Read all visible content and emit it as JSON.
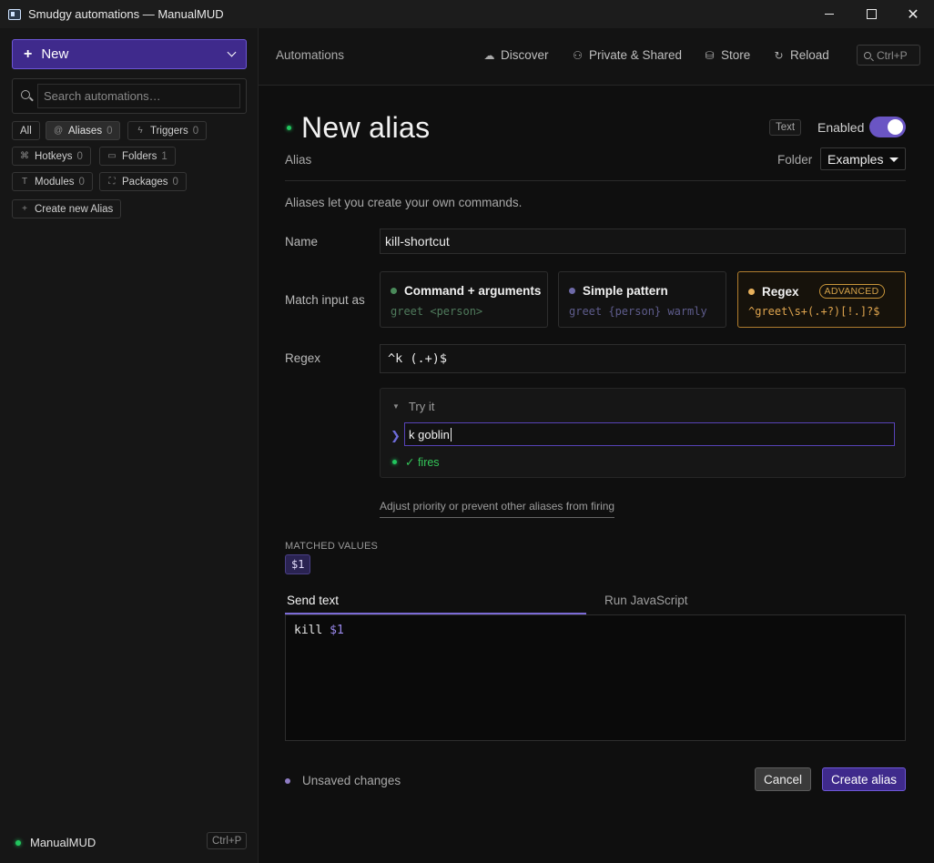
{
  "window": {
    "title": "Smudgy automations — ManualMUD"
  },
  "sidebar": {
    "new_label": "New",
    "search_placeholder": "Search automations…",
    "filters": [
      {
        "label": "All",
        "count": ""
      },
      {
        "label": "Aliases",
        "count": "0"
      },
      {
        "label": "Triggers",
        "count": "0"
      },
      {
        "label": "Hotkeys",
        "count": "0"
      },
      {
        "label": "Folders",
        "count": "1"
      },
      {
        "label": "Modules",
        "count": "0"
      },
      {
        "label": "Packages",
        "count": "0"
      },
      {
        "label": "Create new Alias",
        "count": ""
      }
    ],
    "bottom": {
      "mud_name": "ManualMUD",
      "shortcut": "Ctrl+P"
    }
  },
  "topbar": {
    "title": "Automations",
    "items": [
      {
        "label": "Discover",
        "icon": "cloud-icon"
      },
      {
        "label": "Private & Shared",
        "icon": "user-lock-icon"
      },
      {
        "label": "Store",
        "icon": "database-icon"
      },
      {
        "label": "Reload",
        "icon": "reload-icon"
      }
    ],
    "search_shortcut": "Ctrl+P"
  },
  "form": {
    "title": "New alias",
    "subtitle": "Alias",
    "text_badge": "Text",
    "enabled_label": "Enabled",
    "enabled": true,
    "folder_label": "Folder",
    "folder_value": "Examples",
    "description": "Aliases let you create your own commands.",
    "name_label": "Name",
    "name_value": "kill-shortcut",
    "match_label": "Match input as",
    "match_options": [
      {
        "title": "Command + arguments",
        "example": "greet <person>",
        "dot_color": "#4a8a5a"
      },
      {
        "title": "Simple pattern",
        "example": "greet {person} warmly",
        "dot_color": "#6e6aa8"
      },
      {
        "title": "Regex",
        "badge": "ADVANCED",
        "example": "^greet\\s+(.+?)[!.]?$",
        "dot_color": "#e8b15c"
      }
    ],
    "regex_label": "Regex",
    "regex_value": "^k (.+)$",
    "try_it": {
      "header": "Try it",
      "prompt": "❯",
      "input": "k goblin",
      "result": "✓ fires"
    },
    "adjust_link": "Adjust priority or prevent other aliases from firing",
    "matched_values_label": "MATCHED VALUES",
    "matched_values": [
      "$1"
    ],
    "tabs": [
      "Send text",
      "Run JavaScript"
    ],
    "code": {
      "cmd": "kill",
      "var": "$1"
    },
    "unsaved_label": "Unsaved changes",
    "cancel_label": "Cancel",
    "create_label": "Create alias"
  }
}
